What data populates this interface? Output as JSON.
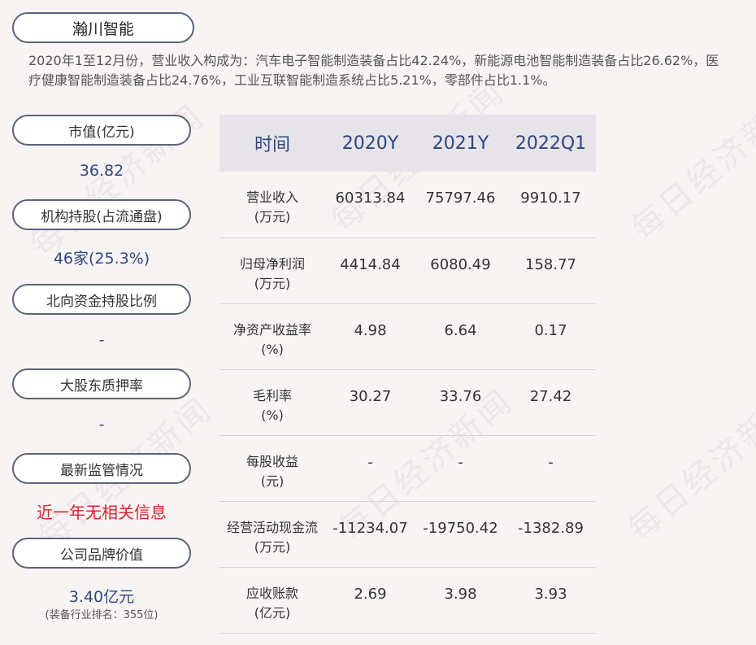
{
  "company": "瀚川智能",
  "summary": "2020年1至12月份，营业收入构成为：汽车电子智能制造装备占比42.24%，新能源电池智能制造装备占比26.62%，医疗健康智能制造装备占比24.76%，工业互联智能制造系统占比5.21%，零部件占比1.1%。",
  "watermark_text": "每日经济新闻",
  "left_panel": [
    {
      "label": "市值(亿元)",
      "value": "36.82"
    },
    {
      "label": "机构持股(占流通盘)",
      "value": "46家(25.3%)"
    },
    {
      "label": "北向资金持股比例",
      "value": "-"
    },
    {
      "label": "大股东质押率",
      "value": "-"
    },
    {
      "label": "最新监管情况",
      "value": "近一年无相关信息"
    },
    {
      "label": "公司品牌价值",
      "value": "3.40亿元",
      "note": "(装备行业排名：355位)"
    }
  ],
  "table": {
    "headers": [
      "时间",
      "2020Y",
      "2021Y",
      "2022Q1"
    ],
    "rows": [
      {
        "name": "营业收入",
        "unit": "(万元)",
        "values": [
          "60313.84",
          "75797.46",
          "9910.17"
        ]
      },
      {
        "name": "归母净利润",
        "unit": "(万元)",
        "values": [
          "4414.84",
          "6080.49",
          "158.77"
        ]
      },
      {
        "name": "净资产收益率",
        "unit": "(%)",
        "values": [
          "4.98",
          "6.64",
          "0.17"
        ]
      },
      {
        "name": "毛利率",
        "unit": "(%)",
        "values": [
          "30.27",
          "33.76",
          "27.42"
        ]
      },
      {
        "name": "每股收益",
        "unit": "(元)",
        "values": [
          "-",
          "-",
          "-"
        ]
      },
      {
        "name": "经营活动现金流",
        "unit": "(万元)",
        "values": [
          "-11234.07",
          "-19750.42",
          "-1382.89"
        ]
      },
      {
        "name": "应收账款",
        "unit": "(亿元)",
        "values": [
          "2.69",
          "3.98",
          "3.93"
        ]
      }
    ]
  }
}
